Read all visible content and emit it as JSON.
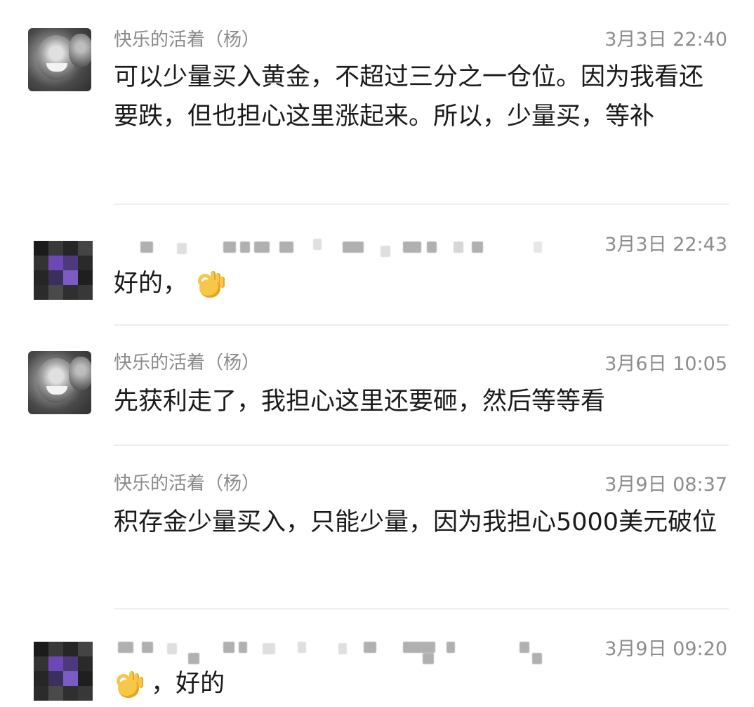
{
  "messages": [
    {
      "sender": "快乐的活着（杨）",
      "time": "3月3日 22:40",
      "text": "可以少量买入黄金，不超过三分之一仓位。因为我看还要跌，但也担心这里涨起来。所以，少量买，等补",
      "avatar": "smiling-child-photo"
    },
    {
      "sender": "",
      "time": "3月3日 22:43",
      "text": "好的，",
      "emoji": "ok-hand-emoji",
      "avatar": "pixelated-avatar"
    },
    {
      "sender": "快乐的活着（杨）",
      "time": "3月6日 10:05",
      "text": "先获利走了，我担心这里还要砸，然后等等看",
      "avatar": "smiling-child-photo"
    },
    {
      "sender": "快乐的活着（杨）",
      "time": "3月9日 08:37",
      "text": "积存金少量买入，只能少量，因为我担心5000美元破位"
    },
    {
      "sender": "",
      "time": "3月9日 09:20",
      "text": "，好的",
      "emoji": "ok-hand-emoji",
      "avatar": "pixelated-avatar"
    }
  ],
  "colors": {
    "background": "#ffffff",
    "sender": "#8a8a8a",
    "time": "#8d8d8d",
    "text": "#1a1a1a",
    "divider": "#eeeeee",
    "emoji": "#f7c74a"
  }
}
